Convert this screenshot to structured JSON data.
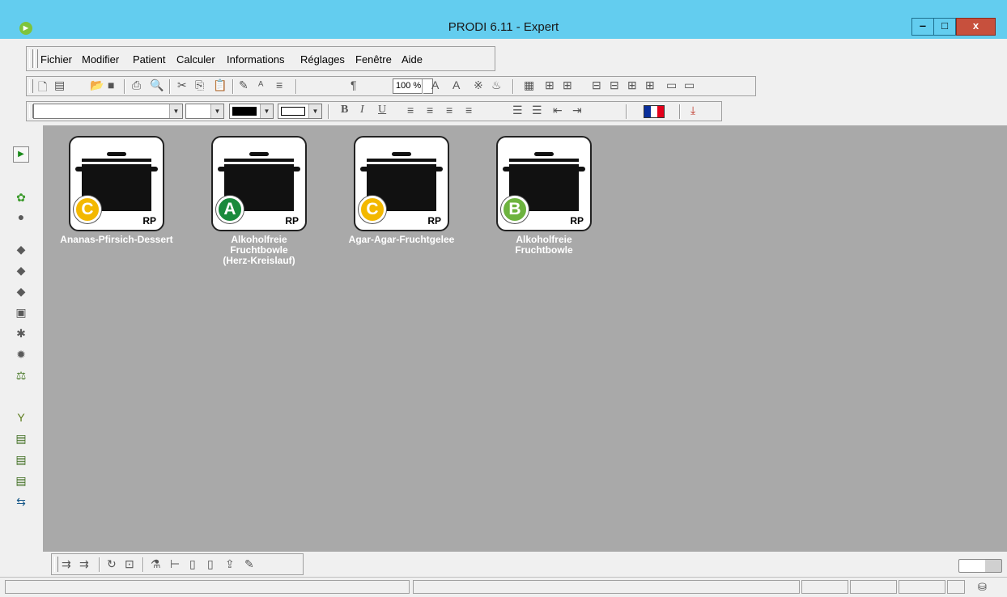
{
  "window": {
    "title": "PRODI 6.11 - Expert",
    "min_glyph": "‒",
    "max_glyph": "□",
    "close_glyph": "x",
    "app_icon": "►"
  },
  "menu": [
    {
      "label": "Fichier"
    },
    {
      "label": "Modifier"
    },
    {
      "label": "Patient"
    },
    {
      "label": "Calculer"
    },
    {
      "label": "Informations"
    },
    {
      "label": "Réglages"
    },
    {
      "label": "Fenêtre"
    },
    {
      "label": "Aide"
    }
  ],
  "toolbar": {
    "zoom": "100 %"
  },
  "recipes": [
    {
      "name": "Ananas-Pfirsich-Dessert",
      "grade": "C",
      "grade_color": "#f3b800",
      "tag": "RP"
    },
    {
      "name": "Alkoholfreie Fruchtbowle (Herz-Kreislauf)",
      "grade": "A",
      "grade_color": "#1a8a3c",
      "tag": "RP"
    },
    {
      "name": "Agar-Agar-Fruchtgelee",
      "grade": "C",
      "grade_color": "#f3b800",
      "tag": "RP"
    },
    {
      "name": "Alkoholfreie Fruchtbowle",
      "grade": "B",
      "grade_color": "#6db33f",
      "tag": "RP"
    }
  ],
  "icons": {
    "left": [
      "plant-icon",
      "pear-icon",
      "pig-icon",
      "chicken-icon",
      "fish-icon",
      "cheese-icon",
      "grain-icon",
      "cake-icon",
      "scale-icon",
      "glass-icon",
      "rp-list-icon",
      "menu-list-icon",
      "day-plan-icon",
      "compare-icon"
    ]
  }
}
